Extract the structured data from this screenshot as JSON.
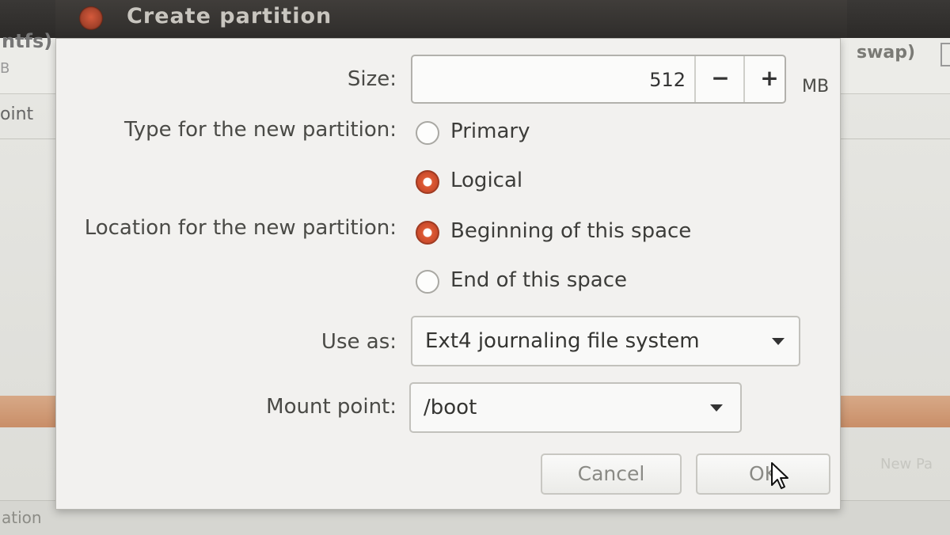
{
  "background": {
    "left_header_label": "ntfs)",
    "left_sub_label": "B",
    "right_header_label": "swap)",
    "left_column_label": "oint",
    "new_button_fragment": "New Pa",
    "bottom_left_label": "ation"
  },
  "dialog": {
    "title": "Create partition",
    "size": {
      "label": "Size:",
      "value": "512",
      "minus": "−",
      "plus": "+",
      "unit": "MB"
    },
    "type": {
      "label": "Type for the new partition:",
      "options": [
        {
          "label": "Primary",
          "selected": false
        },
        {
          "label": "Logical",
          "selected": true
        }
      ]
    },
    "location": {
      "label": "Location for the new partition:",
      "options": [
        {
          "label": "Beginning of this space",
          "selected": true
        },
        {
          "label": "End of this space",
          "selected": false
        }
      ]
    },
    "use_as": {
      "label": "Use as:",
      "value": "Ext4 journaling file system"
    },
    "mount_point": {
      "label": "Mount point:",
      "value": "/boot"
    },
    "buttons": {
      "cancel": "Cancel",
      "ok": "OK"
    }
  },
  "colors": {
    "accent": "#dd5a34",
    "titlebar": "#2f2d2b",
    "dialog_bg": "#f2f1ef"
  }
}
